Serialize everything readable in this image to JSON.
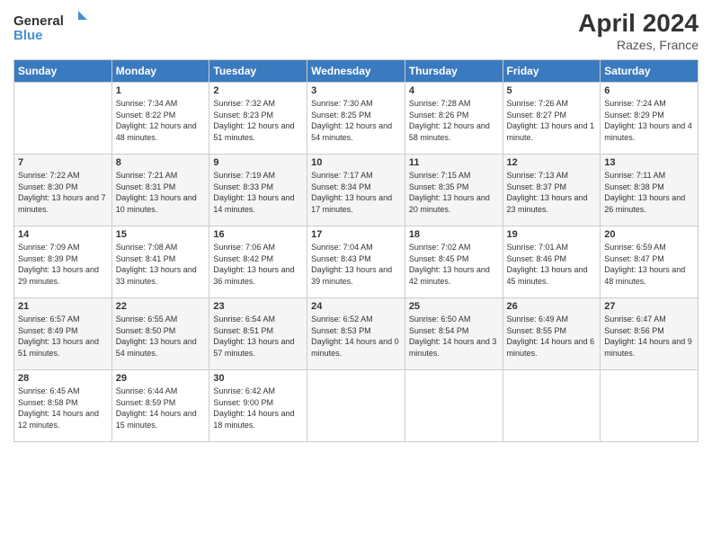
{
  "header": {
    "logo_line1": "General",
    "logo_line2": "Blue",
    "month_year": "April 2024",
    "location": "Razes, France"
  },
  "days_of_week": [
    "Sunday",
    "Monday",
    "Tuesday",
    "Wednesday",
    "Thursday",
    "Friday",
    "Saturday"
  ],
  "weeks": [
    [
      {
        "num": "",
        "sunrise": "",
        "sunset": "",
        "daylight": ""
      },
      {
        "num": "1",
        "sunrise": "Sunrise: 7:34 AM",
        "sunset": "Sunset: 8:22 PM",
        "daylight": "Daylight: 12 hours and 48 minutes."
      },
      {
        "num": "2",
        "sunrise": "Sunrise: 7:32 AM",
        "sunset": "Sunset: 8:23 PM",
        "daylight": "Daylight: 12 hours and 51 minutes."
      },
      {
        "num": "3",
        "sunrise": "Sunrise: 7:30 AM",
        "sunset": "Sunset: 8:25 PM",
        "daylight": "Daylight: 12 hours and 54 minutes."
      },
      {
        "num": "4",
        "sunrise": "Sunrise: 7:28 AM",
        "sunset": "Sunset: 8:26 PM",
        "daylight": "Daylight: 12 hours and 58 minutes."
      },
      {
        "num": "5",
        "sunrise": "Sunrise: 7:26 AM",
        "sunset": "Sunset: 8:27 PM",
        "daylight": "Daylight: 13 hours and 1 minute."
      },
      {
        "num": "6",
        "sunrise": "Sunrise: 7:24 AM",
        "sunset": "Sunset: 8:29 PM",
        "daylight": "Daylight: 13 hours and 4 minutes."
      }
    ],
    [
      {
        "num": "7",
        "sunrise": "Sunrise: 7:22 AM",
        "sunset": "Sunset: 8:30 PM",
        "daylight": "Daylight: 13 hours and 7 minutes."
      },
      {
        "num": "8",
        "sunrise": "Sunrise: 7:21 AM",
        "sunset": "Sunset: 8:31 PM",
        "daylight": "Daylight: 13 hours and 10 minutes."
      },
      {
        "num": "9",
        "sunrise": "Sunrise: 7:19 AM",
        "sunset": "Sunset: 8:33 PM",
        "daylight": "Daylight: 13 hours and 14 minutes."
      },
      {
        "num": "10",
        "sunrise": "Sunrise: 7:17 AM",
        "sunset": "Sunset: 8:34 PM",
        "daylight": "Daylight: 13 hours and 17 minutes."
      },
      {
        "num": "11",
        "sunrise": "Sunrise: 7:15 AM",
        "sunset": "Sunset: 8:35 PM",
        "daylight": "Daylight: 13 hours and 20 minutes."
      },
      {
        "num": "12",
        "sunrise": "Sunrise: 7:13 AM",
        "sunset": "Sunset: 8:37 PM",
        "daylight": "Daylight: 13 hours and 23 minutes."
      },
      {
        "num": "13",
        "sunrise": "Sunrise: 7:11 AM",
        "sunset": "Sunset: 8:38 PM",
        "daylight": "Daylight: 13 hours and 26 minutes."
      }
    ],
    [
      {
        "num": "14",
        "sunrise": "Sunrise: 7:09 AM",
        "sunset": "Sunset: 8:39 PM",
        "daylight": "Daylight: 13 hours and 29 minutes."
      },
      {
        "num": "15",
        "sunrise": "Sunrise: 7:08 AM",
        "sunset": "Sunset: 8:41 PM",
        "daylight": "Daylight: 13 hours and 33 minutes."
      },
      {
        "num": "16",
        "sunrise": "Sunrise: 7:06 AM",
        "sunset": "Sunset: 8:42 PM",
        "daylight": "Daylight: 13 hours and 36 minutes."
      },
      {
        "num": "17",
        "sunrise": "Sunrise: 7:04 AM",
        "sunset": "Sunset: 8:43 PM",
        "daylight": "Daylight: 13 hours and 39 minutes."
      },
      {
        "num": "18",
        "sunrise": "Sunrise: 7:02 AM",
        "sunset": "Sunset: 8:45 PM",
        "daylight": "Daylight: 13 hours and 42 minutes."
      },
      {
        "num": "19",
        "sunrise": "Sunrise: 7:01 AM",
        "sunset": "Sunset: 8:46 PM",
        "daylight": "Daylight: 13 hours and 45 minutes."
      },
      {
        "num": "20",
        "sunrise": "Sunrise: 6:59 AM",
        "sunset": "Sunset: 8:47 PM",
        "daylight": "Daylight: 13 hours and 48 minutes."
      }
    ],
    [
      {
        "num": "21",
        "sunrise": "Sunrise: 6:57 AM",
        "sunset": "Sunset: 8:49 PM",
        "daylight": "Daylight: 13 hours and 51 minutes."
      },
      {
        "num": "22",
        "sunrise": "Sunrise: 6:55 AM",
        "sunset": "Sunset: 8:50 PM",
        "daylight": "Daylight: 13 hours and 54 minutes."
      },
      {
        "num": "23",
        "sunrise": "Sunrise: 6:54 AM",
        "sunset": "Sunset: 8:51 PM",
        "daylight": "Daylight: 13 hours and 57 minutes."
      },
      {
        "num": "24",
        "sunrise": "Sunrise: 6:52 AM",
        "sunset": "Sunset: 8:53 PM",
        "daylight": "Daylight: 14 hours and 0 minutes."
      },
      {
        "num": "25",
        "sunrise": "Sunrise: 6:50 AM",
        "sunset": "Sunset: 8:54 PM",
        "daylight": "Daylight: 14 hours and 3 minutes."
      },
      {
        "num": "26",
        "sunrise": "Sunrise: 6:49 AM",
        "sunset": "Sunset: 8:55 PM",
        "daylight": "Daylight: 14 hours and 6 minutes."
      },
      {
        "num": "27",
        "sunrise": "Sunrise: 6:47 AM",
        "sunset": "Sunset: 8:56 PM",
        "daylight": "Daylight: 14 hours and 9 minutes."
      }
    ],
    [
      {
        "num": "28",
        "sunrise": "Sunrise: 6:45 AM",
        "sunset": "Sunset: 8:58 PM",
        "daylight": "Daylight: 14 hours and 12 minutes."
      },
      {
        "num": "29",
        "sunrise": "Sunrise: 6:44 AM",
        "sunset": "Sunset: 8:59 PM",
        "daylight": "Daylight: 14 hours and 15 minutes."
      },
      {
        "num": "30",
        "sunrise": "Sunrise: 6:42 AM",
        "sunset": "Sunset: 9:00 PM",
        "daylight": "Daylight: 14 hours and 18 minutes."
      },
      {
        "num": "",
        "sunrise": "",
        "sunset": "",
        "daylight": ""
      },
      {
        "num": "",
        "sunrise": "",
        "sunset": "",
        "daylight": ""
      },
      {
        "num": "",
        "sunrise": "",
        "sunset": "",
        "daylight": ""
      },
      {
        "num": "",
        "sunrise": "",
        "sunset": "",
        "daylight": ""
      }
    ]
  ]
}
